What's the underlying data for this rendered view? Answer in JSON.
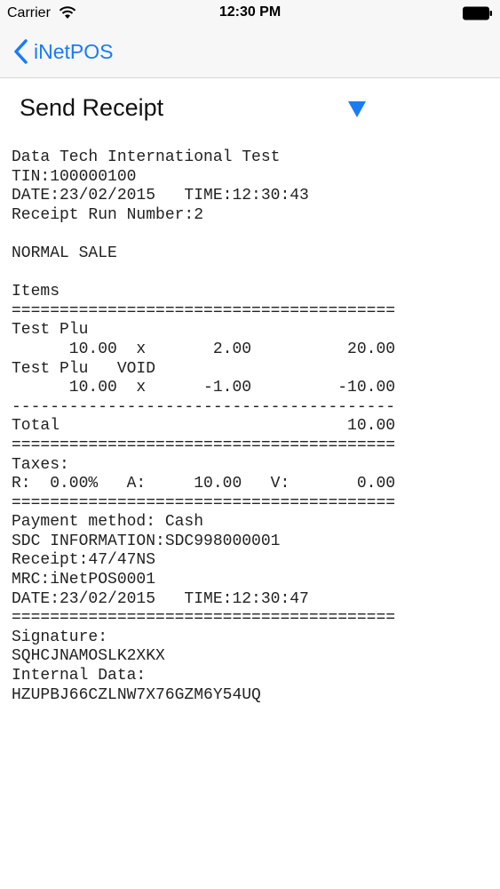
{
  "status_bar": {
    "carrier": "Carrier",
    "time": "12:30 PM"
  },
  "nav": {
    "back_label": "iNetPOS"
  },
  "header": {
    "title": "Send Receipt",
    "dropdown_icon": "triangle-down-icon"
  },
  "colors": {
    "accent": "#1a7cf5",
    "bar_background": "#f7f7f7"
  },
  "receipt_lines": [
    "Data Tech International Test",
    "TIN:100000100",
    "DATE:23/02/2015   TIME:12:30:43",
    "Receipt Run Number:2",
    "",
    "NORMAL SALE",
    "",
    "Items",
    "========================================",
    "Test Plu",
    "      10.00  x       2.00          20.00",
    "Test Plu   VOID",
    "      10.00  x      -1.00         -10.00",
    "----------------------------------------",
    "Total                              10.00",
    "========================================",
    "Taxes:",
    "R:  0.00%   A:     10.00   V:       0.00",
    "========================================",
    "Payment method: Cash",
    "SDC INFORMATION:SDC998000001",
    "Receipt:47/47NS",
    "MRC:iNetPOS0001",
    "DATE:23/02/2015   TIME:12:30:47",
    "========================================",
    "Signature:",
    "SQHCJNAMOSLK2XKX",
    "Internal Data:",
    "HZUPBJ66CZLNW7X76GZM6Y54UQ"
  ]
}
